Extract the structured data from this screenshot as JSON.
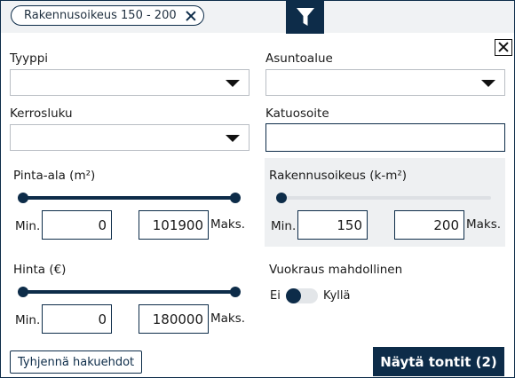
{
  "chips": [
    {
      "label": "Rakennusoikeus 150 - 200"
    }
  ],
  "icons": {
    "filter": "filter-funnel-icon",
    "close": "close-x-icon",
    "dropdown": "caret-down-icon"
  },
  "colors": {
    "primary": "#0d2c49",
    "panel_grey": "#eef0f2",
    "strip_grey": "#f0f2f4"
  },
  "fields": {
    "tyyppi": {
      "label": "Tyyppi",
      "value": ""
    },
    "asuntoalue": {
      "label": "Asuntoalue",
      "value": ""
    },
    "kerrosluku": {
      "label": "Kerrosluku",
      "value": ""
    },
    "katuosoite": {
      "label": "Katuosoite",
      "value": ""
    }
  },
  "ranges": {
    "pinta_ala": {
      "label": "Pinta-ala (m²)",
      "min_label": "Min.",
      "max_label": "Maks.",
      "min": "0",
      "max": "101900",
      "slider_fraction": [
        0.0,
        1.0
      ]
    },
    "rakennusoikeus": {
      "label": "Rakennusoikeus (k-m²)",
      "min_label": "Min.",
      "max_label": "Maks.",
      "min": "150",
      "max": "200",
      "slider_fraction": [
        0.0,
        0.0
      ]
    },
    "hinta": {
      "label": "Hinta (€)",
      "min_label": "Min.",
      "max_label": "Maks.",
      "min": "0",
      "max": "180000",
      "slider_fraction": [
        0.0,
        1.0
      ]
    }
  },
  "rental": {
    "label": "Vuokraus mahdollinen",
    "off_label": "Ei",
    "on_label": "Kyllä",
    "checked": false
  },
  "actions": {
    "clear": "Tyhjennä hakuehdot",
    "show": "Näytä tontit (2)"
  }
}
